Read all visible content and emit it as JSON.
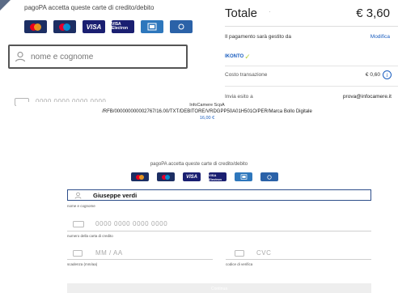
{
  "top_form": {
    "cards_caption": "pagoPA accetta queste carte di credito/debito",
    "cards": [
      {
        "name": "mastercard-icon",
        "label": ""
      },
      {
        "name": "maestro-icon",
        "label": ""
      },
      {
        "name": "visa-icon",
        "label": "VISA"
      },
      {
        "name": "visa-electron-icon",
        "label": "VISA Electron"
      },
      {
        "name": "amex-icon",
        "label": ""
      },
      {
        "name": "diners-icon",
        "label": ""
      }
    ],
    "name_placeholder": "nome e cognome",
    "card_number_placeholder": "0000 0000 0000 0000"
  },
  "summary": {
    "total_label": "Totale",
    "total_amount": "€ 3,60",
    "managed_by_label": "Il pagamento sarà gestito da",
    "edit_link": "Modifica",
    "provider_name": "IKONTO",
    "fee_label": "Costo transazione",
    "fee_amount": "€ 0,60",
    "send_label": "Invia esito a",
    "send_email": "prova@infocamere.it"
  },
  "overlay": {
    "company": "InfoCamere ScpA",
    "path": "/RFB/000000000002767/16.00/TXT/DEBITORE/VRDGPP50A01H501O/PER/Marca Bollo Digitale",
    "amount": "16,00 €"
  },
  "form": {
    "cards_caption": "pagoPA accetta queste carte di credito/debito",
    "name_value": "Giuseppe verdi",
    "name_label": "nome e cognome",
    "card_number_placeholder": "0000 0000 0000 0000",
    "card_number_label": "numero della carta di credito",
    "expiry_placeholder": "MM / AA",
    "expiry_label": "scadenza (mm/aa)",
    "cvc_placeholder": "CVC",
    "cvc_label": "codice di verifica",
    "continue_label": "Continua"
  },
  "colors": {
    "accent": "#1a5dbf",
    "focus_border": "#2d4e8a",
    "mastercard_red": "#eb001b",
    "mastercard_orange": "#f79e1b",
    "visa_blue": "#1a1f71"
  }
}
